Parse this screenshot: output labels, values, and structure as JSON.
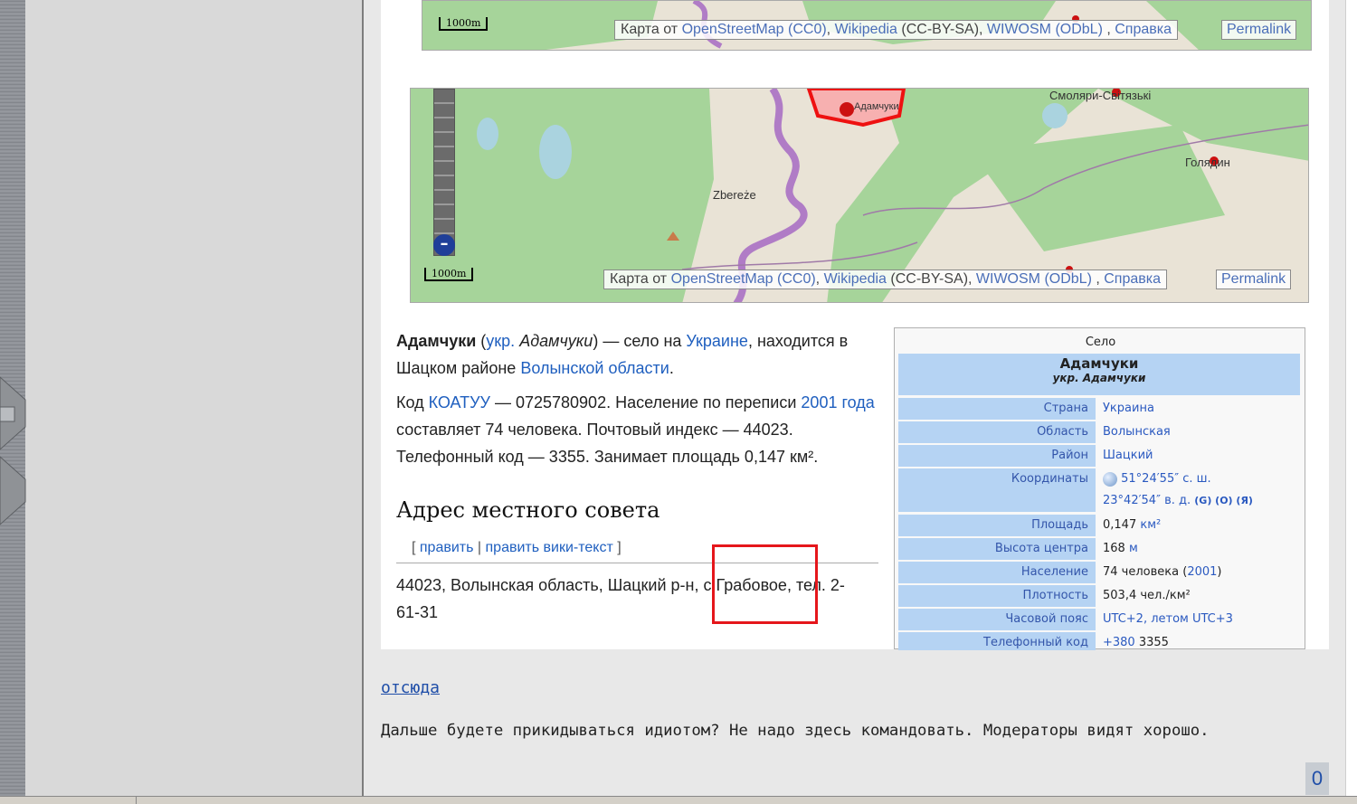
{
  "map1": {
    "scale": "1000m",
    "attrib": {
      "prefix": "Карта от",
      "osm": "OpenStreetMap",
      "cc0": "(CC0)",
      "wikipedia": "Wikipedia",
      "ccbysa": "(CC-BY-SA)",
      "wiwosm": "WIWOSM",
      "odbl": "(ODbL)",
      "help": "Справка"
    },
    "permalink": "Permalink"
  },
  "map2": {
    "scale": "1000m",
    "labels": {
      "village1": "Смоляри-Світязькі",
      "village2": "Голядин",
      "village3": "Zbereże",
      "village4": "Адамчуки"
    },
    "attrib": {
      "prefix": "Карта от",
      "osm": "OpenStreetMap",
      "cc0": "(CC0)",
      "wikipedia": "Wikipedia",
      "ccbysa": "(CC-BY-SA)",
      "wiwosm": "WIWOSM",
      "odbl": "(ODbL)",
      "help": "Справка"
    },
    "permalink": "Permalink",
    "zoom_minus": "–"
  },
  "article": {
    "p1": {
      "name": "Адамчуки",
      "open": " (",
      "ukr_link": "укр.",
      "ukr_name": " Адамчуки",
      "rest": ") — село на ",
      "country_link": "Украине",
      "rest2": ", находится в Шацком районе ",
      "region_link": "Волынской области",
      "end": "."
    },
    "p2": {
      "t1": "Код ",
      "koatuu_link": "КОАТУУ",
      "t2": " — 0725780902. Население по переписи ",
      "census_link": "2001 года",
      "t3": " составляет 74 человека. Почтовый индекс — 44023. Телефонный код — 3355. Занимает площадь 0,147 км²."
    },
    "section_title": "Адрес местного совета",
    "edit": {
      "open": "[ ",
      "edit_link": "править",
      "sep": " | ",
      "edit_wiki_link": "править вики-текст",
      "close": " ]"
    },
    "address": "44023, Волынская область, Шацкий р-н, с.Грабовое, тел. 2-61-31"
  },
  "infobox": {
    "kind": "Село",
    "title": "Адамчуки",
    "subtitle": "укр. Адамчуки",
    "rows": [
      {
        "label": "Страна",
        "value": "Украина"
      },
      {
        "label": "Область",
        "value": "Волынская"
      },
      {
        "label": "Район",
        "value": "Шацкий"
      },
      {
        "label": "Координаты",
        "value": "51°24′55″ с. ш.",
        "value2": "23°42′54″ в. д.",
        "extra": "(G) (O) (Я)"
      },
      {
        "label": "Площадь",
        "value": "0,147 ",
        "unit": "км²"
      },
      {
        "label": "Высота центра",
        "value": "168 ",
        "unit": "м"
      },
      {
        "label": "Население",
        "value": "74 человека (",
        "year": "2001",
        "value_end": ")"
      },
      {
        "label": "Плотность",
        "value": "503,4 чел./км²"
      },
      {
        "label": "Часовой пояс",
        "value": "UTC+2",
        "value2": ", летом UTC+3"
      },
      {
        "label": "Телефонный код",
        "value": "+380",
        "value2": " 3355"
      }
    ]
  },
  "post": {
    "source_link": "отсюда",
    "comment": "Дальше будете прикидываться идиотом? Не надо здесь командовать. Модераторы видят хорошо.",
    "counter": "0"
  },
  "colors": {
    "accent_red": "#e5161b",
    "link_blue": "#1f5fbf",
    "infobox_blue": "#b5d3f3",
    "forest_green": "#a6d49a",
    "river_purple": "#b07cc6"
  }
}
